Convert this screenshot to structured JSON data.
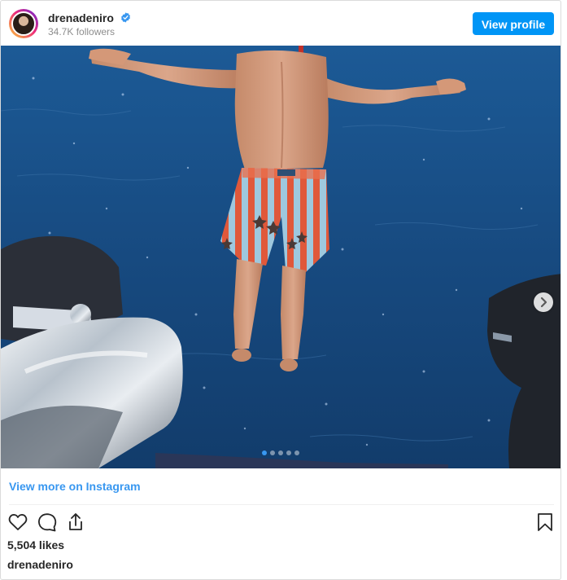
{
  "header": {
    "username": "drenadeniro",
    "followers": "34.7K followers",
    "view_profile_label": "View profile",
    "verified_icon": "verified-badge-icon"
  },
  "post": {
    "image_icon": "photo-diver-jumping-into-sea",
    "carousel": {
      "total": 5,
      "current": 1
    },
    "next_icon": "chevron-right-icon"
  },
  "footer": {
    "view_more_label": "View more on Instagram",
    "likes": "5,504 likes",
    "caption_username": "drenadeniro",
    "icons": [
      "heart-icon",
      "comment-icon",
      "share-icon",
      "bookmark-icon"
    ]
  },
  "colors": {
    "primary_button": "#0095f6",
    "link": "#3897f0",
    "text": "#262626",
    "muted": "#8e8e8e",
    "sea": "#1b4f86"
  }
}
